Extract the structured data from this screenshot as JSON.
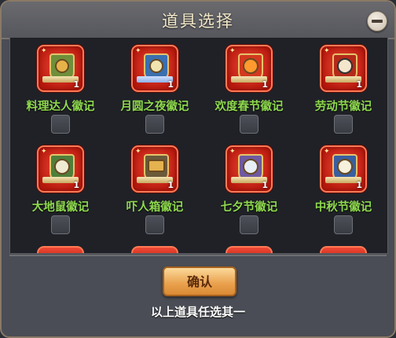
{
  "dialog": {
    "title": "道具选择",
    "confirm_label": "确认",
    "footer_note": "以上道具任选其一"
  },
  "items": [
    {
      "name": "料理达人徽记",
      "count": "1",
      "icon": "cooking-badge-icon",
      "color": "#6f8f3a"
    },
    {
      "name": "月圆之夜徽记",
      "count": "1",
      "icon": "full-moon-badge-icon",
      "color": "#3a6fb0"
    },
    {
      "name": "欢度春节徽记",
      "count": "1",
      "icon": "spring-festival-badge-icon",
      "color": "#d23a1f"
    },
    {
      "name": "劳动节徽记",
      "count": "1",
      "icon": "labor-day-badge-icon",
      "color": "#b52a1a"
    },
    {
      "name": "大地鼠徽记",
      "count": "1",
      "icon": "gopher-badge-icon",
      "color": "#4f7f3a"
    },
    {
      "name": "吓人箱徽记",
      "count": "1",
      "icon": "scary-box-badge-icon",
      "color": "#6a5a3a"
    },
    {
      "name": "七夕节徽记",
      "count": "1",
      "icon": "qixi-badge-icon",
      "color": "#6f5aa0"
    },
    {
      "name": "中秋节徽记",
      "count": "1",
      "icon": "mid-autumn-badge-icon",
      "color": "#3a5fa0"
    }
  ]
}
